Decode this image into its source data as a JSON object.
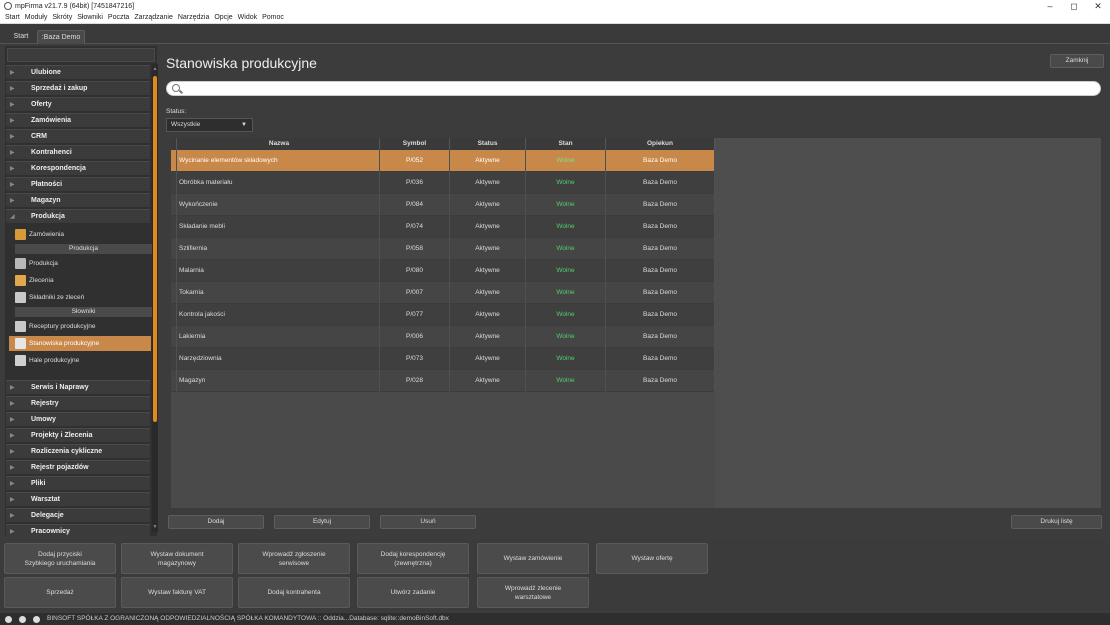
{
  "window": {
    "title": "mpFirma v21.7.9 (64bit) [7451847216]",
    "controls": [
      "–",
      "◻",
      "✕"
    ]
  },
  "menu": [
    "Start",
    "Moduły",
    "Skróty",
    "Słowniki",
    "Poczta",
    "Zarządzanie",
    "Narzędzia",
    "Opcje",
    "Widok",
    "Pomoc"
  ],
  "tabs": [
    "Start",
    ":Baza Demo"
  ],
  "sidebar": {
    "top_categories": [
      "Ulubione",
      "Sprzedaż i zakup",
      "Oferty",
      "Zamówienia",
      "CRM",
      "Kontrahenci",
      "Korespondencja",
      "Płatności",
      "Magazyn",
      "Produkcja"
    ],
    "produkcja_items": {
      "zamowienia": "Zamówienia",
      "group_produkcja": "Produkcja",
      "produkcja": "Produkcja",
      "zlecenia": "Zlecenia",
      "skladniki": "Składniki ze zleceń",
      "group_slowniki": "Słowniki",
      "receptury": "Receptury produkcyjne",
      "stanowiska": "Stanowiska produkcyjne",
      "hale": "Hale produkcyjne"
    },
    "bottom_categories": [
      "Serwis i Naprawy",
      "Rejestry",
      "Umowy",
      "Projekty i Zlecenia",
      "Rozliczenia cykliczne",
      "Rejestr pojazdów",
      "Pliki",
      "Warsztat",
      "Delegacje",
      "Pracownicy"
    ]
  },
  "main": {
    "title": "Stanowiska produkcyjne",
    "close_label": "Zamknij",
    "search_placeholder": "",
    "status_label": "Status:",
    "status_value": "Wszystkie",
    "columns": [
      "Nazwa",
      "Symbol",
      "Status",
      "Stan",
      "Opiekun"
    ],
    "rows": [
      {
        "nazwa": "Wycinanie elementów składowych",
        "symbol": "P/052",
        "status": "Aktywne",
        "stan": "Wolne",
        "opiekun": "Baza Demo"
      },
      {
        "nazwa": "Obróbka materiału",
        "symbol": "P/036",
        "status": "Aktywne",
        "stan": "Wolne",
        "opiekun": "Baza Demo"
      },
      {
        "nazwa": "Wykończenie",
        "symbol": "P/084",
        "status": "Aktywne",
        "stan": "Wolne",
        "opiekun": "Baza Demo"
      },
      {
        "nazwa": "Składanie mebli",
        "symbol": "P/074",
        "status": "Aktywne",
        "stan": "Wolne",
        "opiekun": "Baza Demo"
      },
      {
        "nazwa": "Szlifiernia",
        "symbol": "P/058",
        "status": "Aktywne",
        "stan": "Wolne",
        "opiekun": "Baza Demo"
      },
      {
        "nazwa": "Malarnia",
        "symbol": "P/080",
        "status": "Aktywne",
        "stan": "Wolne",
        "opiekun": "Baza Demo"
      },
      {
        "nazwa": "Tokarnia",
        "symbol": "P/007",
        "status": "Aktywne",
        "stan": "Wolne",
        "opiekun": "Baza Demo"
      },
      {
        "nazwa": "Kontrola jakości",
        "symbol": "P/077",
        "status": "Aktywne",
        "stan": "Wolne",
        "opiekun": "Baza Demo"
      },
      {
        "nazwa": "Lakiernia",
        "symbol": "P/006",
        "status": "Aktywne",
        "stan": "Wolne",
        "opiekun": "Baza Demo"
      },
      {
        "nazwa": "Narzędziownia",
        "symbol": "P/073",
        "status": "Aktywne",
        "stan": "Wolne",
        "opiekun": "Baza Demo"
      },
      {
        "nazwa": "Magazyn",
        "symbol": "P/028",
        "status": "Aktywne",
        "stan": "Wolne",
        "opiekun": "Baza Demo"
      }
    ],
    "buttons": {
      "add": "Dodaj",
      "edit": "Edytuj",
      "delete": "Usuń",
      "print": "Drukuj listę"
    }
  },
  "quick_actions": [
    "Dodaj przyciski\nSzybkiego uruchamiania",
    "Wystaw dokument\nmagazynowy",
    "Wprowadź zgłoszenie\nserwisowe",
    "Dodaj korespondencję\n(zewnętrzna)",
    "Wystaw zamówienie",
    "Wystaw ofertę",
    "Sprzedaż",
    "Wystaw fakturę VAT",
    "Dodaj kontrahenta",
    "Utwórz zadanie",
    "Wprowadź zlecenie\nwarsztatowe"
  ],
  "statusbar": {
    "text": "BINSOFT SPÓŁKA Z OGRANICZONĄ ODPOWIEDZIALNOŚCIĄ SPÓŁKA KOMANDYTOWA :: Oddzia...Database: sqlite::demoBinSoft.dbx"
  },
  "colors": {
    "accent": "#c8884a",
    "scroll_accent": "#e08a1e",
    "stan_green": "#4fd06a"
  }
}
